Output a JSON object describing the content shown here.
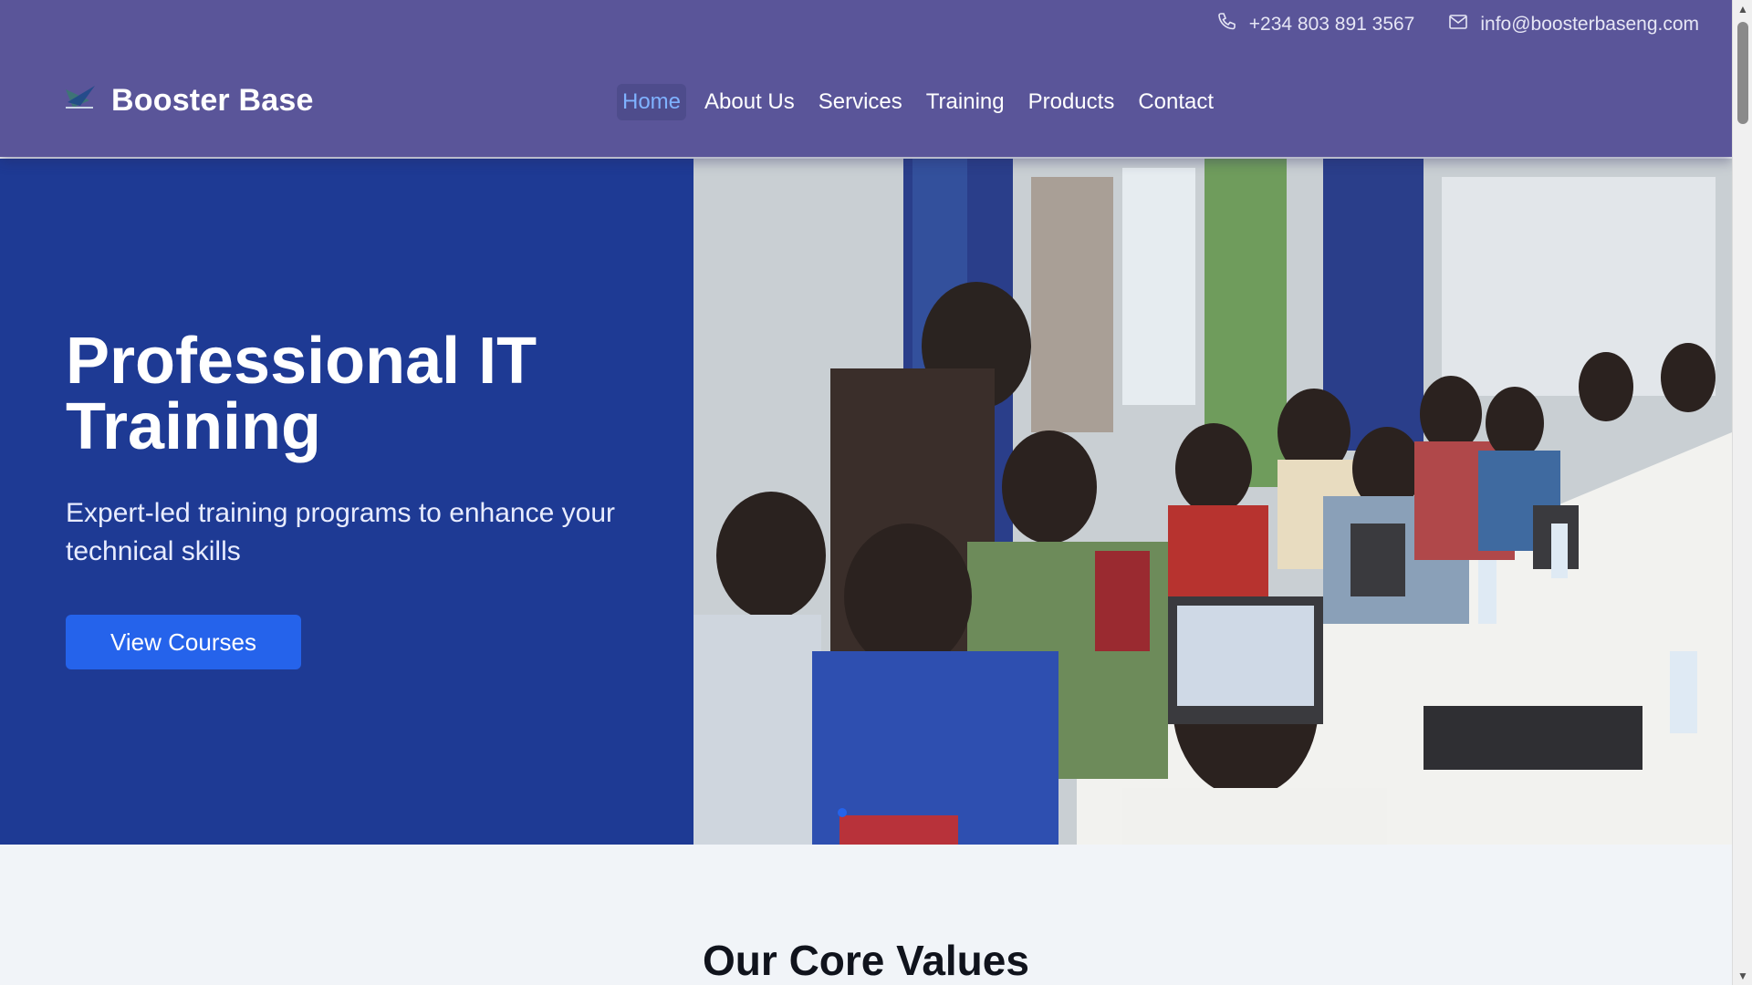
{
  "header": {
    "phone": "+234 803 891 3567",
    "email": "info@boosterbaseng.com",
    "brand": "Booster Base",
    "nav": [
      {
        "label": "Home",
        "active": true
      },
      {
        "label": "About Us"
      },
      {
        "label": "Services"
      },
      {
        "label": "Training"
      },
      {
        "label": "Products"
      },
      {
        "label": "Contact"
      }
    ]
  },
  "hero": {
    "title": "Professional IT Training",
    "subtitle": "Expert-led training programs to enhance your technical skills",
    "cta": "View Courses"
  },
  "section": {
    "title": "Our Core Values"
  },
  "colors": {
    "header_bg": "#5a5599",
    "hero_panel": "#1e3a94",
    "accent": "#2563eb",
    "nav_active": "#7fb2ff"
  }
}
